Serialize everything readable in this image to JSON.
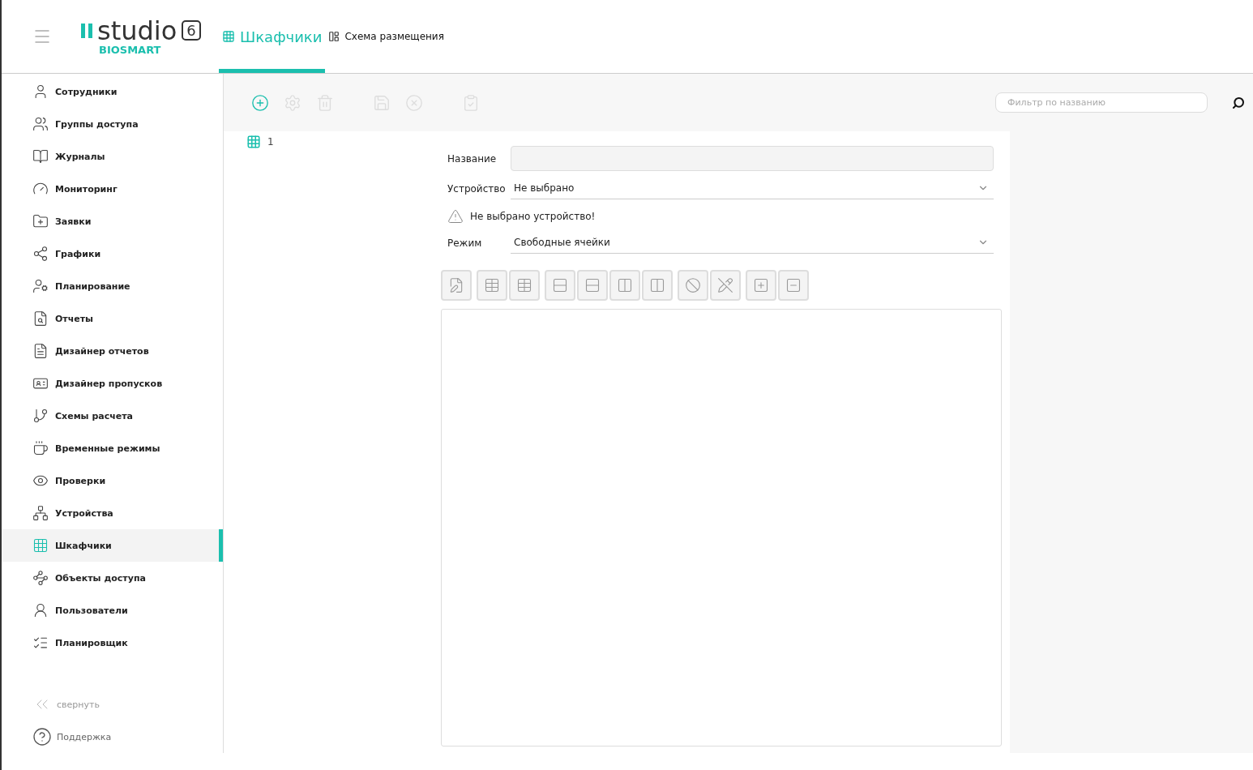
{
  "header": {
    "logo": {
      "word": "studio",
      "version": "6",
      "brand": "BIOSMART"
    },
    "tabs": [
      {
        "label": "Шкафчики",
        "selected": true
      },
      {
        "label": "Схема размещения",
        "selected": false
      }
    ]
  },
  "sidebar": {
    "items": [
      {
        "label": "Сотрудники",
        "selected": false
      },
      {
        "label": "Группы доступа",
        "selected": false
      },
      {
        "label": "Журналы",
        "selected": false
      },
      {
        "label": "Мониторинг",
        "selected": false
      },
      {
        "label": "Заявки",
        "selected": false
      },
      {
        "label": "Графики",
        "selected": false
      },
      {
        "label": "Планирование",
        "selected": false
      },
      {
        "label": "Отчеты",
        "selected": false
      },
      {
        "label": "Дизайнер отчетов",
        "selected": false
      },
      {
        "label": "Дизайнер пропусков",
        "selected": false
      },
      {
        "label": "Схемы расчета",
        "selected": false
      },
      {
        "label": "Временные режимы",
        "selected": false
      },
      {
        "label": "Проверки",
        "selected": false
      },
      {
        "label": "Устройства",
        "selected": false
      },
      {
        "label": "Шкафчики",
        "selected": true
      },
      {
        "label": "Объекты доступа",
        "selected": false
      },
      {
        "label": "Пользователи",
        "selected": false
      },
      {
        "label": "Планировщик",
        "selected": false
      }
    ],
    "collapse": "свернуть",
    "support": "Поддержка"
  },
  "toolbar": {
    "buttons": [
      {
        "disabled": false
      },
      {
        "disabled": true
      },
      {
        "disabled": true
      },
      {
        "disabled": true
      },
      {
        "disabled": true
      },
      {
        "disabled": true
      }
    ],
    "filter": {
      "placeholder": "Фильтр по названию"
    }
  },
  "tree": {
    "items": [
      {
        "label": "1",
        "selected": false
      }
    ]
  },
  "form": {
    "name": {
      "label": "Название"
    },
    "device": {
      "label": "Устройство",
      "value": "Не выбрано"
    },
    "warning": "Не выбрано устройство!",
    "mode": {
      "label": "Режим",
      "value": "Свободные ячейки"
    },
    "tool_groups": [
      [
        {
          "disabled": true
        }
      ],
      [
        {
          "disabled": true
        },
        {
          "disabled": true
        }
      ],
      [
        {
          "disabled": true
        },
        {
          "disabled": true
        },
        {
          "disabled": true
        },
        {
          "disabled": true
        }
      ],
      [
        {
          "disabled": true
        },
        {
          "disabled": true
        }
      ],
      [
        {
          "disabled": true
        },
        {
          "disabled": true
        }
      ]
    ]
  }
}
